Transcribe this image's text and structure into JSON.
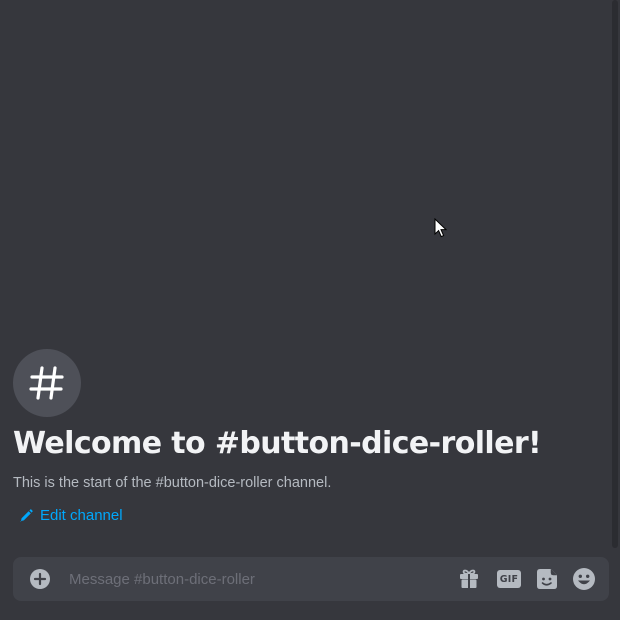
{
  "channel": {
    "icon": "hash-icon",
    "welcome_title": "Welcome to #button-dice-roller!",
    "welcome_subtitle": "This is the start of the #button-dice-roller channel.",
    "edit_label": "Edit channel"
  },
  "composer": {
    "placeholder": "Message #button-dice-roller",
    "value": "",
    "gif_label": "GIF",
    "icons": [
      "plus-circle-icon",
      "gift-icon",
      "gif-icon",
      "sticker-icon",
      "emoji-icon"
    ]
  },
  "colors": {
    "background": "#36373d",
    "composer_bg": "#404249",
    "link": "#00a8fc",
    "title": "#f2f3f5",
    "subtitle": "#b5bac1"
  }
}
